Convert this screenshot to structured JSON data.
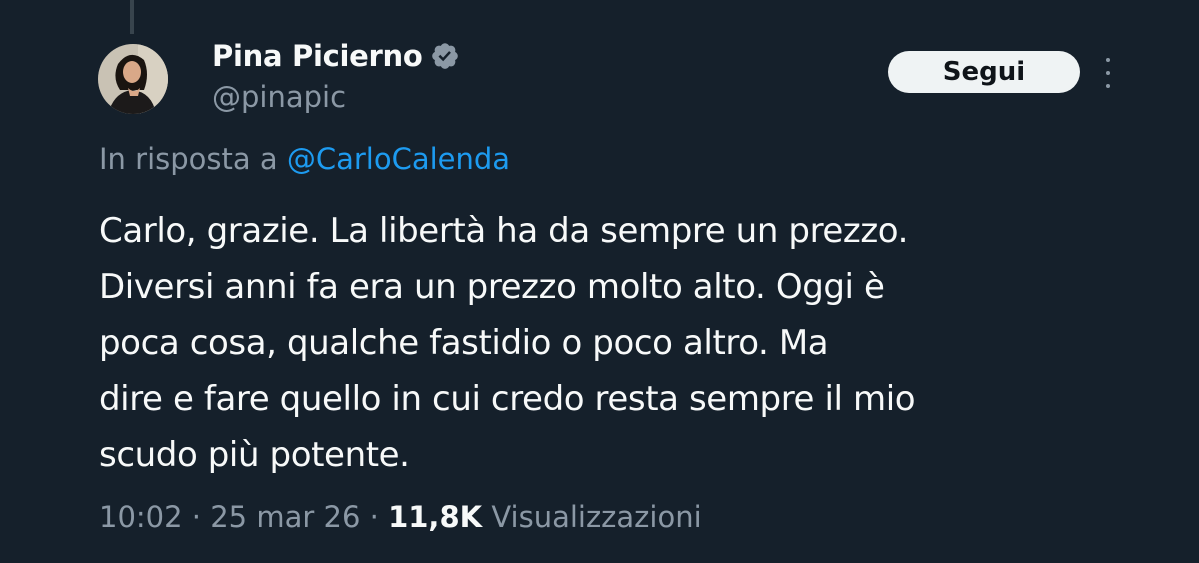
{
  "author": {
    "display_name": "Pina Picierno",
    "handle": "@pinapic",
    "verified": true,
    "avatar_icon": "profile-photo"
  },
  "actions": {
    "follow_label": "Segui",
    "more_icon": "more-options-icon"
  },
  "reply": {
    "prefix": "In risposta a",
    "mention": "@CarloCalenda"
  },
  "tweet": {
    "text": "Carlo, grazie. La libertà ha da sempre un prezzo.\nDiversi anni fa era un prezzo molto alto. Oggi è\npoca cosa, qualche fastidio o poco altro. Ma\ndire e fare quello in cui credo resta sempre il mio\nscudo più potente."
  },
  "meta": {
    "time": "10:02",
    "date": "25 mar 26",
    "views_count": "11,8K",
    "views_label": "Visualizzazioni",
    "separator": "·"
  },
  "colors": {
    "background": "#15202b",
    "text_primary": "#f7f9f9",
    "text_secondary": "#8b98a5",
    "accent": "#1d9bf0",
    "follow_bg": "#eff3f4"
  }
}
